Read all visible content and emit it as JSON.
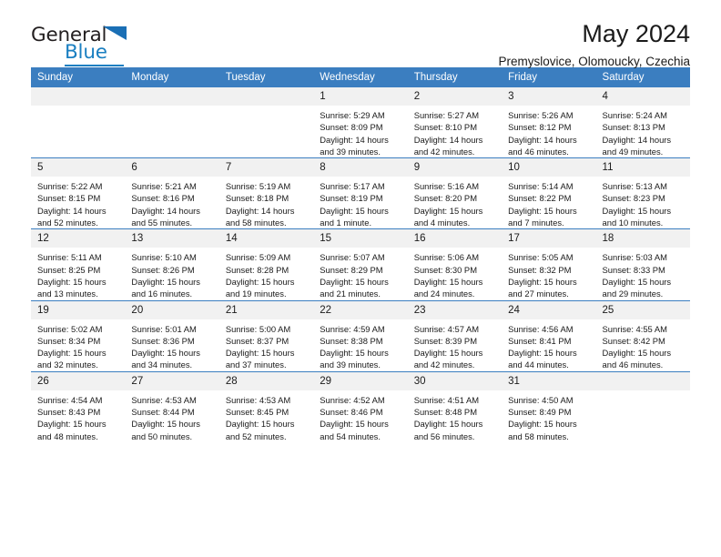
{
  "brand": {
    "name_part1": "General",
    "name_part2": "Blue",
    "accent_color": "#1a7fc1",
    "triangle_icon": "triangle-icon"
  },
  "header": {
    "title": "May 2024",
    "subtitle": "Premyslovice, Olomoucky, Czechia"
  },
  "calendar": {
    "header_color": "#3b7ec0",
    "daynum_band_color": "#f1f1f1",
    "weekday_headers": [
      "Sunday",
      "Monday",
      "Tuesday",
      "Wednesday",
      "Thursday",
      "Friday",
      "Saturday"
    ],
    "weeks": [
      [
        {
          "day": "",
          "empty": true,
          "sunrise": "",
          "sunset": "",
          "daylight1": "",
          "daylight2": ""
        },
        {
          "day": "",
          "empty": true,
          "sunrise": "",
          "sunset": "",
          "daylight1": "",
          "daylight2": ""
        },
        {
          "day": "",
          "empty": true,
          "sunrise": "",
          "sunset": "",
          "daylight1": "",
          "daylight2": ""
        },
        {
          "day": "1",
          "empty": false,
          "sunrise": "Sunrise: 5:29 AM",
          "sunset": "Sunset: 8:09 PM",
          "daylight1": "Daylight: 14 hours",
          "daylight2": "and 39 minutes."
        },
        {
          "day": "2",
          "empty": false,
          "sunrise": "Sunrise: 5:27 AM",
          "sunset": "Sunset: 8:10 PM",
          "daylight1": "Daylight: 14 hours",
          "daylight2": "and 42 minutes."
        },
        {
          "day": "3",
          "empty": false,
          "sunrise": "Sunrise: 5:26 AM",
          "sunset": "Sunset: 8:12 PM",
          "daylight1": "Daylight: 14 hours",
          "daylight2": "and 46 minutes."
        },
        {
          "day": "4",
          "empty": false,
          "sunrise": "Sunrise: 5:24 AM",
          "sunset": "Sunset: 8:13 PM",
          "daylight1": "Daylight: 14 hours",
          "daylight2": "and 49 minutes."
        }
      ],
      [
        {
          "day": "5",
          "empty": false,
          "sunrise": "Sunrise: 5:22 AM",
          "sunset": "Sunset: 8:15 PM",
          "daylight1": "Daylight: 14 hours",
          "daylight2": "and 52 minutes."
        },
        {
          "day": "6",
          "empty": false,
          "sunrise": "Sunrise: 5:21 AM",
          "sunset": "Sunset: 8:16 PM",
          "daylight1": "Daylight: 14 hours",
          "daylight2": "and 55 minutes."
        },
        {
          "day": "7",
          "empty": false,
          "sunrise": "Sunrise: 5:19 AM",
          "sunset": "Sunset: 8:18 PM",
          "daylight1": "Daylight: 14 hours",
          "daylight2": "and 58 minutes."
        },
        {
          "day": "8",
          "empty": false,
          "sunrise": "Sunrise: 5:17 AM",
          "sunset": "Sunset: 8:19 PM",
          "daylight1": "Daylight: 15 hours",
          "daylight2": "and 1 minute."
        },
        {
          "day": "9",
          "empty": false,
          "sunrise": "Sunrise: 5:16 AM",
          "sunset": "Sunset: 8:20 PM",
          "daylight1": "Daylight: 15 hours",
          "daylight2": "and 4 minutes."
        },
        {
          "day": "10",
          "empty": false,
          "sunrise": "Sunrise: 5:14 AM",
          "sunset": "Sunset: 8:22 PM",
          "daylight1": "Daylight: 15 hours",
          "daylight2": "and 7 minutes."
        },
        {
          "day": "11",
          "empty": false,
          "sunrise": "Sunrise: 5:13 AM",
          "sunset": "Sunset: 8:23 PM",
          "daylight1": "Daylight: 15 hours",
          "daylight2": "and 10 minutes."
        }
      ],
      [
        {
          "day": "12",
          "empty": false,
          "sunrise": "Sunrise: 5:11 AM",
          "sunset": "Sunset: 8:25 PM",
          "daylight1": "Daylight: 15 hours",
          "daylight2": "and 13 minutes."
        },
        {
          "day": "13",
          "empty": false,
          "sunrise": "Sunrise: 5:10 AM",
          "sunset": "Sunset: 8:26 PM",
          "daylight1": "Daylight: 15 hours",
          "daylight2": "and 16 minutes."
        },
        {
          "day": "14",
          "empty": false,
          "sunrise": "Sunrise: 5:09 AM",
          "sunset": "Sunset: 8:28 PM",
          "daylight1": "Daylight: 15 hours",
          "daylight2": "and 19 minutes."
        },
        {
          "day": "15",
          "empty": false,
          "sunrise": "Sunrise: 5:07 AM",
          "sunset": "Sunset: 8:29 PM",
          "daylight1": "Daylight: 15 hours",
          "daylight2": "and 21 minutes."
        },
        {
          "day": "16",
          "empty": false,
          "sunrise": "Sunrise: 5:06 AM",
          "sunset": "Sunset: 8:30 PM",
          "daylight1": "Daylight: 15 hours",
          "daylight2": "and 24 minutes."
        },
        {
          "day": "17",
          "empty": false,
          "sunrise": "Sunrise: 5:05 AM",
          "sunset": "Sunset: 8:32 PM",
          "daylight1": "Daylight: 15 hours",
          "daylight2": "and 27 minutes."
        },
        {
          "day": "18",
          "empty": false,
          "sunrise": "Sunrise: 5:03 AM",
          "sunset": "Sunset: 8:33 PM",
          "daylight1": "Daylight: 15 hours",
          "daylight2": "and 29 minutes."
        }
      ],
      [
        {
          "day": "19",
          "empty": false,
          "sunrise": "Sunrise: 5:02 AM",
          "sunset": "Sunset: 8:34 PM",
          "daylight1": "Daylight: 15 hours",
          "daylight2": "and 32 minutes."
        },
        {
          "day": "20",
          "empty": false,
          "sunrise": "Sunrise: 5:01 AM",
          "sunset": "Sunset: 8:36 PM",
          "daylight1": "Daylight: 15 hours",
          "daylight2": "and 34 minutes."
        },
        {
          "day": "21",
          "empty": false,
          "sunrise": "Sunrise: 5:00 AM",
          "sunset": "Sunset: 8:37 PM",
          "daylight1": "Daylight: 15 hours",
          "daylight2": "and 37 minutes."
        },
        {
          "day": "22",
          "empty": false,
          "sunrise": "Sunrise: 4:59 AM",
          "sunset": "Sunset: 8:38 PM",
          "daylight1": "Daylight: 15 hours",
          "daylight2": "and 39 minutes."
        },
        {
          "day": "23",
          "empty": false,
          "sunrise": "Sunrise: 4:57 AM",
          "sunset": "Sunset: 8:39 PM",
          "daylight1": "Daylight: 15 hours",
          "daylight2": "and 42 minutes."
        },
        {
          "day": "24",
          "empty": false,
          "sunrise": "Sunrise: 4:56 AM",
          "sunset": "Sunset: 8:41 PM",
          "daylight1": "Daylight: 15 hours",
          "daylight2": "and 44 minutes."
        },
        {
          "day": "25",
          "empty": false,
          "sunrise": "Sunrise: 4:55 AM",
          "sunset": "Sunset: 8:42 PM",
          "daylight1": "Daylight: 15 hours",
          "daylight2": "and 46 minutes."
        }
      ],
      [
        {
          "day": "26",
          "empty": false,
          "sunrise": "Sunrise: 4:54 AM",
          "sunset": "Sunset: 8:43 PM",
          "daylight1": "Daylight: 15 hours",
          "daylight2": "and 48 minutes."
        },
        {
          "day": "27",
          "empty": false,
          "sunrise": "Sunrise: 4:53 AM",
          "sunset": "Sunset: 8:44 PM",
          "daylight1": "Daylight: 15 hours",
          "daylight2": "and 50 minutes."
        },
        {
          "day": "28",
          "empty": false,
          "sunrise": "Sunrise: 4:53 AM",
          "sunset": "Sunset: 8:45 PM",
          "daylight1": "Daylight: 15 hours",
          "daylight2": "and 52 minutes."
        },
        {
          "day": "29",
          "empty": false,
          "sunrise": "Sunrise: 4:52 AM",
          "sunset": "Sunset: 8:46 PM",
          "daylight1": "Daylight: 15 hours",
          "daylight2": "and 54 minutes."
        },
        {
          "day": "30",
          "empty": false,
          "sunrise": "Sunrise: 4:51 AM",
          "sunset": "Sunset: 8:48 PM",
          "daylight1": "Daylight: 15 hours",
          "daylight2": "and 56 minutes."
        },
        {
          "day": "31",
          "empty": false,
          "sunrise": "Sunrise: 4:50 AM",
          "sunset": "Sunset: 8:49 PM",
          "daylight1": "Daylight: 15 hours",
          "daylight2": "and 58 minutes."
        },
        {
          "day": "",
          "empty": true,
          "sunrise": "",
          "sunset": "",
          "daylight1": "",
          "daylight2": ""
        }
      ]
    ]
  }
}
